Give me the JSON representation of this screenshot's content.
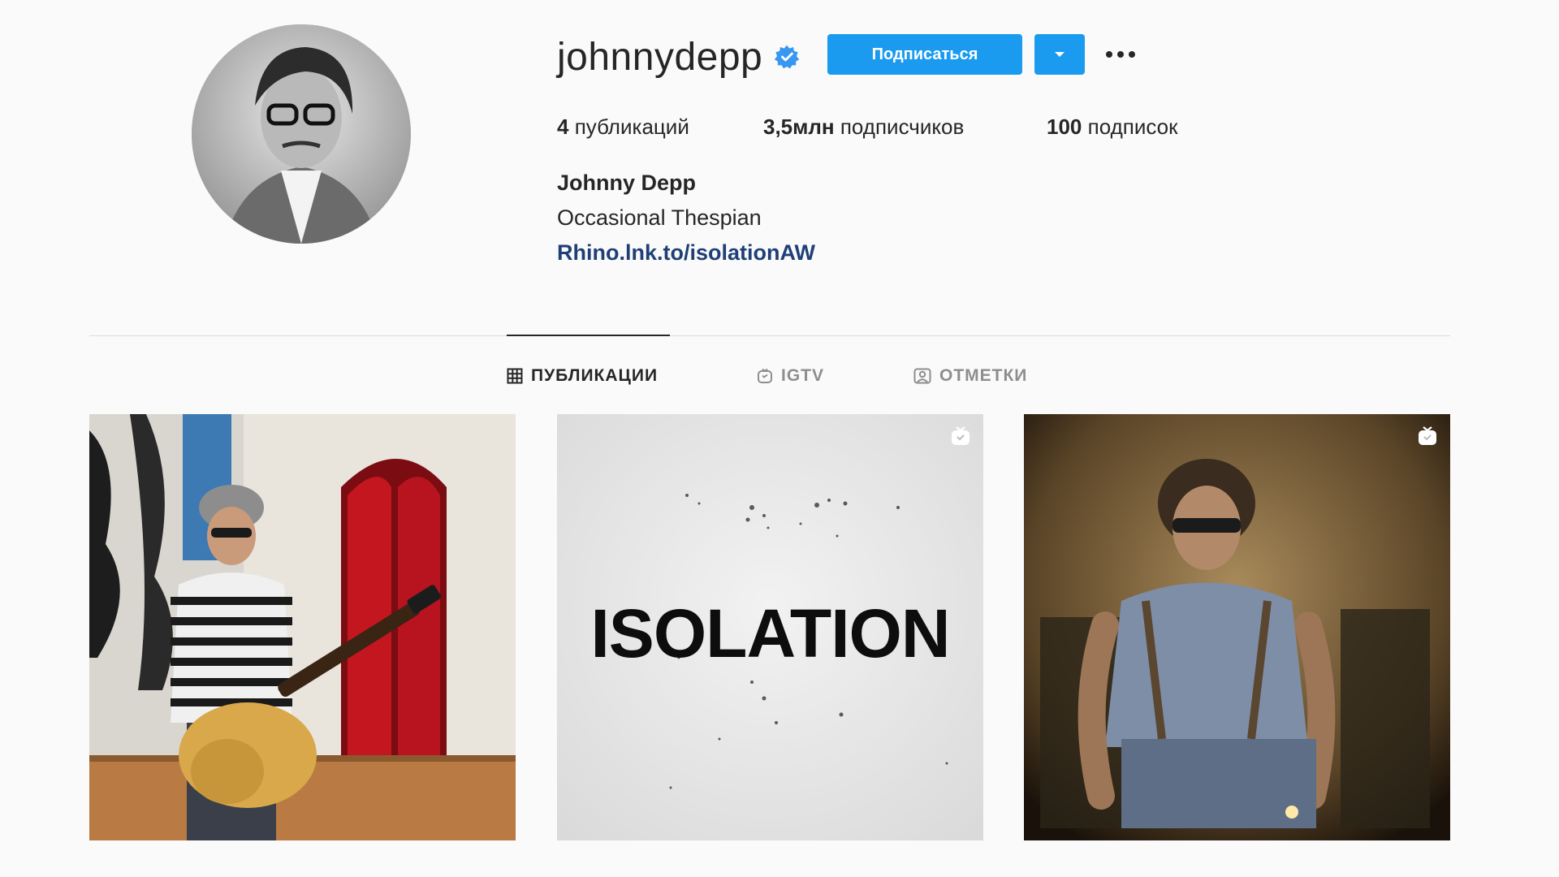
{
  "profile": {
    "username": "johnnydepp",
    "verified": true,
    "full_name": "Johnny Depp",
    "bio": "Occasional Thespian",
    "link": "Rhino.lnk.to/isolationAW",
    "avatar_icon": "profile-photo"
  },
  "actions": {
    "follow_label": "Подписаться",
    "dropdown_icon": "caret-down-icon",
    "more_icon": "ellipsis-icon"
  },
  "stats": {
    "posts_count": "4",
    "posts_label": "публикаций",
    "followers_count": "3,5млн",
    "followers_label": "подписчиков",
    "following_count": "100",
    "following_label": "подписок"
  },
  "tabs": [
    {
      "label": "ПУБЛИКАЦИИ",
      "icon": "grid-icon",
      "active": true
    },
    {
      "label": "IGTV",
      "icon": "igtv-icon",
      "active": false
    },
    {
      "label": "ОТМЕТКИ",
      "icon": "tagged-icon",
      "active": false
    }
  ],
  "posts": [
    {
      "type": "photo",
      "badge": null
    },
    {
      "type": "video",
      "badge": "igtv-badge-icon",
      "overlay_text": "ISOLATION"
    },
    {
      "type": "video",
      "badge": "igtv-badge-icon"
    }
  ],
  "colors": {
    "accent": "#1a9bf0",
    "link": "#1f3f77",
    "background": "#fafafa",
    "text": "#262626",
    "muted": "#8e8e8e"
  }
}
